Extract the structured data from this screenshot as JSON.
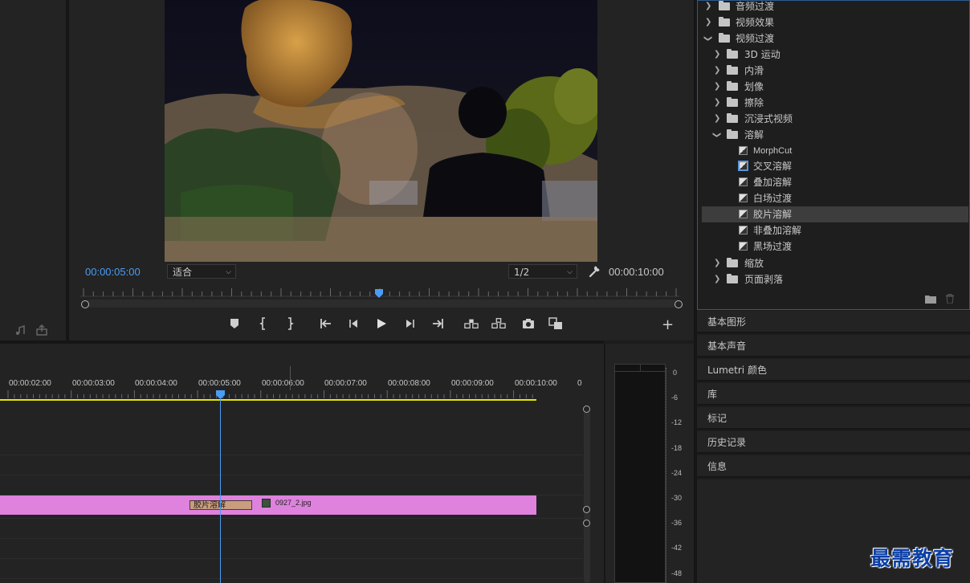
{
  "monitor": {
    "current_timecode": "00:00:05:00",
    "zoom_value": "适合",
    "resolution_value": "1/2",
    "duration_timecode": "00:00:10:00"
  },
  "timeline": {
    "ruler_labels": [
      "00:00:02:00",
      "00:00:03:00",
      "00:00:04:00",
      "00:00:05:00",
      "00:00:06:00",
      "00:00:07:00",
      "00:00:08:00",
      "00:00:09:00",
      "00:00:10:00",
      "0"
    ],
    "transition_label": "胶片溶解",
    "clip_name": "0927_2.jpg"
  },
  "audio_meter": {
    "db_labels": [
      "0",
      "-6",
      "-12",
      "-18",
      "-24",
      "-30",
      "-36",
      "-42",
      "-48"
    ]
  },
  "effects_tree": [
    {
      "label": "音频过渡",
      "type": "folder",
      "level": 0,
      "expanded": false
    },
    {
      "label": "视频效果",
      "type": "folder",
      "level": 0,
      "expanded": false
    },
    {
      "label": "视频过渡",
      "type": "folder",
      "level": 0,
      "expanded": true
    },
    {
      "label": "3D 运动",
      "type": "folder",
      "level": 1,
      "expanded": false
    },
    {
      "label": "内滑",
      "type": "folder",
      "level": 1,
      "expanded": false
    },
    {
      "label": "划像",
      "type": "folder",
      "level": 1,
      "expanded": false
    },
    {
      "label": "擦除",
      "type": "folder",
      "level": 1,
      "expanded": false
    },
    {
      "label": "沉浸式视频",
      "type": "folder",
      "level": 1,
      "expanded": false
    },
    {
      "label": "溶解",
      "type": "folder",
      "level": 1,
      "expanded": true
    },
    {
      "label": "MorphCut",
      "type": "effect",
      "level": 2
    },
    {
      "label": "交叉溶解",
      "type": "effect",
      "level": 2,
      "focused": true
    },
    {
      "label": "叠加溶解",
      "type": "effect",
      "level": 2
    },
    {
      "label": "白场过渡",
      "type": "effect",
      "level": 2
    },
    {
      "label": "胶片溶解",
      "type": "effect",
      "level": 2,
      "selected": true
    },
    {
      "label": "非叠加溶解",
      "type": "effect",
      "level": 2
    },
    {
      "label": "黑场过渡",
      "type": "effect",
      "level": 2
    },
    {
      "label": "缩放",
      "type": "folder",
      "level": 1,
      "expanded": false
    },
    {
      "label": "页面剥落",
      "type": "folder",
      "level": 1,
      "expanded": false
    }
  ],
  "collapsed_panels": [
    "基本图形",
    "基本声音",
    "Lumetri 颜色",
    "库",
    "标记",
    "历史记录",
    "信息"
  ],
  "watermark": "最需教育",
  "colors": {
    "accent_blue": "#4a9cf4",
    "clip_pink": "#de82de",
    "transition_tan": "#c99e7e",
    "work_area_yellow": "#e8e800"
  }
}
